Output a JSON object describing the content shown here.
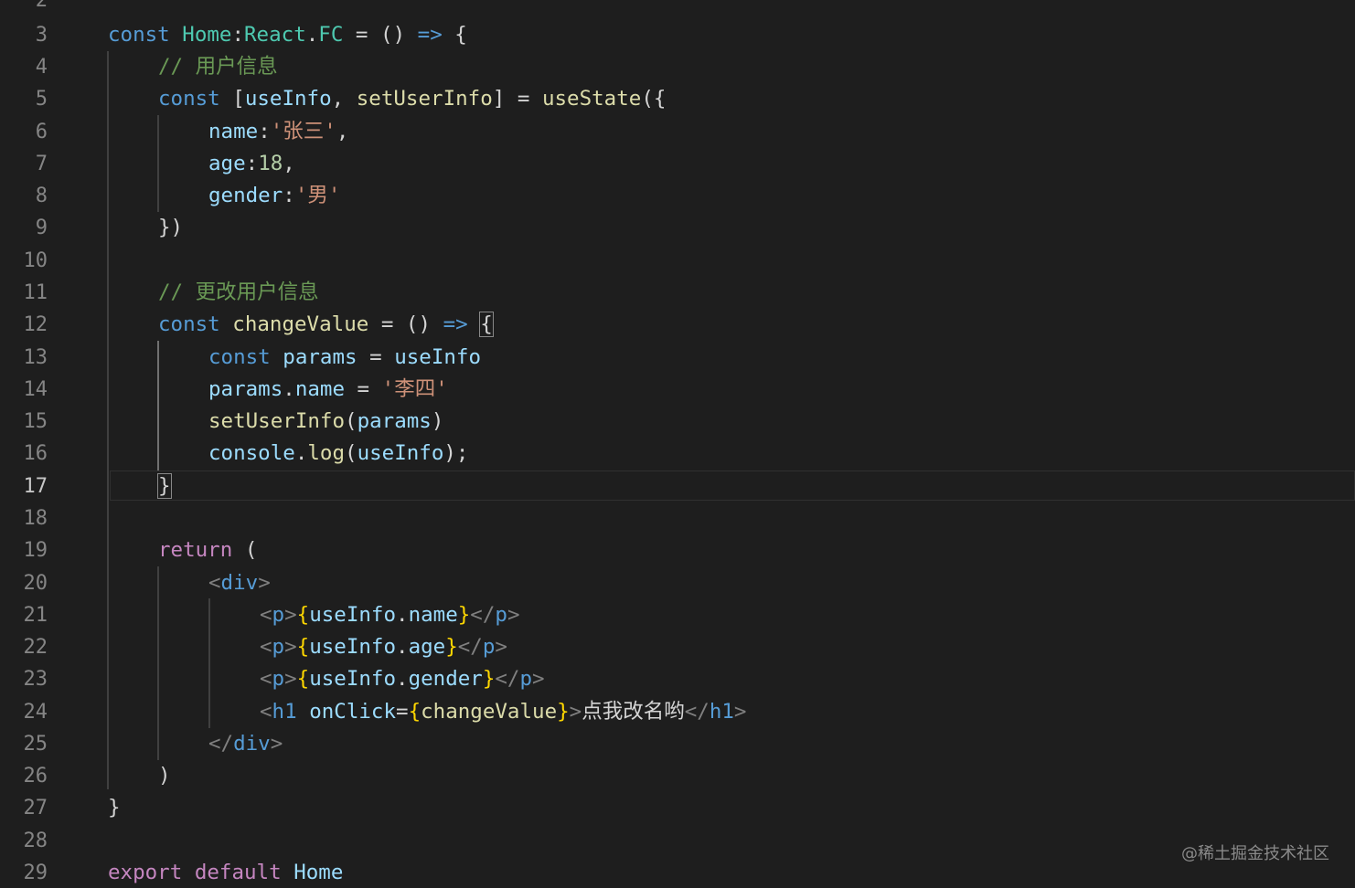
{
  "editor": {
    "watermark": "@稀土掘金技术社区",
    "current_line": "17",
    "lines": [
      {
        "n": "2"
      },
      {
        "n": "3",
        "t": [
          "const",
          "Home",
          ":",
          "React",
          ".",
          "FC",
          " = () ",
          "=>",
          " {"
        ]
      },
      {
        "n": "4",
        "t": [
          "// 用户信息"
        ]
      },
      {
        "n": "5",
        "t": [
          "const",
          " [",
          "useInfo",
          ", ",
          "setUserInfo",
          "] = ",
          "useState",
          "({"
        ]
      },
      {
        "n": "6",
        "t": [
          "name",
          ":",
          "'张三'",
          ","
        ]
      },
      {
        "n": "7",
        "t": [
          "age",
          ":",
          "18",
          ","
        ]
      },
      {
        "n": "8",
        "t": [
          "gender",
          ":",
          "'男'"
        ]
      },
      {
        "n": "9",
        "t": [
          "})"
        ]
      },
      {
        "n": "10"
      },
      {
        "n": "11",
        "t": [
          "// 更改用户信息"
        ]
      },
      {
        "n": "12",
        "t": [
          "const",
          "changeValue",
          " = () ",
          "=>",
          " ",
          "{"
        ]
      },
      {
        "n": "13",
        "t": [
          "const",
          "params",
          " = ",
          "useInfo"
        ]
      },
      {
        "n": "14",
        "t": [
          "params",
          ".",
          "name",
          " = ",
          "'李四'"
        ]
      },
      {
        "n": "15",
        "t": [
          "setUserInfo",
          "(",
          "params",
          ")"
        ]
      },
      {
        "n": "16",
        "t": [
          "console",
          ".",
          "log",
          "(",
          "useInfo",
          ");"
        ]
      },
      {
        "n": "17",
        "t": [
          "}"
        ]
      },
      {
        "n": "18"
      },
      {
        "n": "19",
        "t": [
          "return",
          " ("
        ]
      },
      {
        "n": "20",
        "t": [
          "<",
          "div",
          ">"
        ]
      },
      {
        "n": "21",
        "t": [
          "<",
          "p",
          ">",
          "{",
          "useInfo",
          ".",
          "name",
          "}",
          "</",
          "p",
          ">"
        ]
      },
      {
        "n": "22",
        "t": [
          "<",
          "p",
          ">",
          "{",
          "useInfo",
          ".",
          "age",
          "}",
          "</",
          "p",
          ">"
        ]
      },
      {
        "n": "23",
        "t": [
          "<",
          "p",
          ">",
          "{",
          "useInfo",
          ".",
          "gender",
          "}",
          "</",
          "p",
          ">"
        ]
      },
      {
        "n": "24",
        "t": [
          "<",
          "h1",
          "onClick",
          "=",
          "{",
          "changeValue",
          "}",
          ">",
          "点我改名哟",
          "</",
          "h1",
          ">"
        ]
      },
      {
        "n": "25",
        "t": [
          "</",
          "div",
          ">"
        ]
      },
      {
        "n": "26",
        "t": [
          ")"
        ]
      },
      {
        "n": "27",
        "t": [
          "}"
        ]
      },
      {
        "n": "28"
      },
      {
        "n": "29",
        "t": [
          "export",
          "default",
          "Home"
        ]
      }
    ]
  }
}
